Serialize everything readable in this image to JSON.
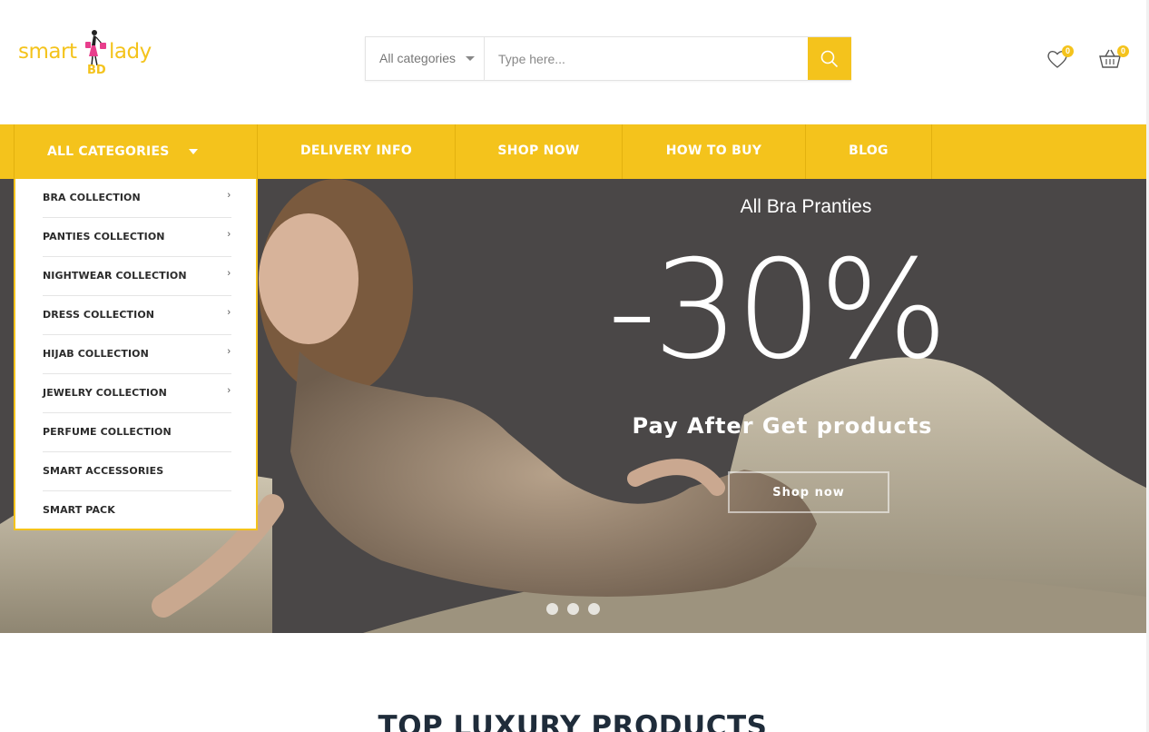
{
  "brand": {
    "word1": "smart",
    "word2": "lady",
    "sub": "BD",
    "accent_color": "#f4c31c"
  },
  "search": {
    "category_label": "All categories",
    "placeholder": "Type here...",
    "button_icon": "search-icon"
  },
  "header_icons": {
    "wishlist_icon": "heart-icon",
    "wishlist_count": "0",
    "cart_icon": "basket-icon",
    "cart_count": "0"
  },
  "nav": {
    "all_categories": "ALL CATEGORIES",
    "items": [
      {
        "label": "DELIVERY INFO"
      },
      {
        "label": "SHOP NOW"
      },
      {
        "label": "HOW TO BUY"
      },
      {
        "label": "BLOG"
      }
    ]
  },
  "categories": [
    {
      "label": "BRA COLLECTION",
      "has_submenu": true
    },
    {
      "label": "PANTIES COLLECTION",
      "has_submenu": true
    },
    {
      "label": "NIGHTWEAR COLLECTION",
      "has_submenu": true
    },
    {
      "label": "DRESS COLLECTION",
      "has_submenu": true
    },
    {
      "label": "HIJAB COLLECTION",
      "has_submenu": true
    },
    {
      "label": "JEWELRY COLLECTION",
      "has_submenu": true
    },
    {
      "label": "PERFUME COLLECTION",
      "has_submenu": false
    },
    {
      "label": "SMART ACCESSORIES",
      "has_submenu": false
    },
    {
      "label": "SMART PACK",
      "has_submenu": false
    }
  ],
  "hero": {
    "title": "All Bra Pranties",
    "discount": "-30%",
    "subtitle": "Pay After Get products",
    "button": "Shop now",
    "slides": 3,
    "active_slide": 2
  },
  "section": {
    "title": "TOP LUXURY PRODUCTS"
  }
}
